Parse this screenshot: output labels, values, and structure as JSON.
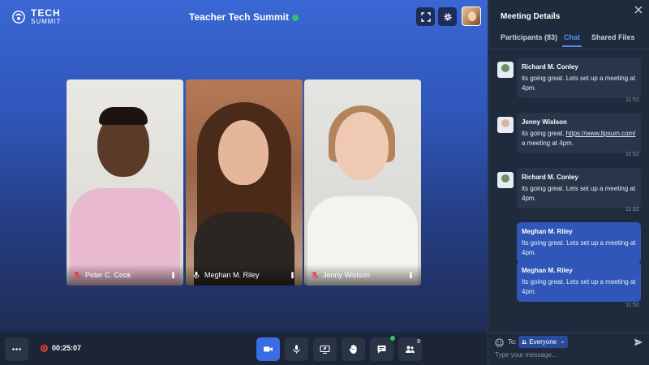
{
  "app": {
    "logo_line1": "TECH",
    "logo_line2": "SUMMIT",
    "meeting_title": "Teacher Tech Summit"
  },
  "participants": [
    {
      "name": "Peter C. Cook",
      "muted": true
    },
    {
      "name": "Meghan M. Riley",
      "muted": false
    },
    {
      "name": "Jenny Wislson",
      "muted": true
    }
  ],
  "toolbar": {
    "recording_time": "00:25:07",
    "participants_count": "8",
    "icons": [
      "more-icon",
      "video-icon",
      "mic-icon",
      "screen-share-icon",
      "raise-hand-icon",
      "chat-icon",
      "participants-icon"
    ]
  },
  "panel": {
    "title": "Meeting Details",
    "tabs": [
      {
        "label": "Participants (83)",
        "active": false
      },
      {
        "label": "Chat",
        "active": true
      },
      {
        "label": "Shared Files",
        "active": false
      }
    ],
    "messages": [
      {
        "sender": "Richard M. Conley",
        "text": "its going great. Lets set up a meeting at 4pm.",
        "time": "11:52"
      },
      {
        "sender": "Jenny Wislson",
        "text_before": "its going great. ",
        "link": "https://www.lipsum.com/",
        "text_after": " a meeting at 4pm.",
        "time": "11:52"
      },
      {
        "sender": "Richard M. Conley",
        "text": "its going great. Lets set up a meeting at 4pm.",
        "time": "11:52"
      },
      {
        "sender": "Meghan M. Riley",
        "text": "Its going great. Lets set up a meeting at 4pm.",
        "mine": true
      },
      {
        "sender": "Meghan M. Riley",
        "text": "Its going great. Lets set up a meeting at 4pm.",
        "time": "11:52",
        "mine": true
      }
    ],
    "composer": {
      "to_label": "To:",
      "recipient": "Everyone",
      "placeholder": "Type your message..."
    }
  },
  "colors": {
    "accent": "#3a6ce3",
    "online": "#2ec46a",
    "record": "#e23b3b",
    "panel_bg": "#1f2a3c"
  }
}
